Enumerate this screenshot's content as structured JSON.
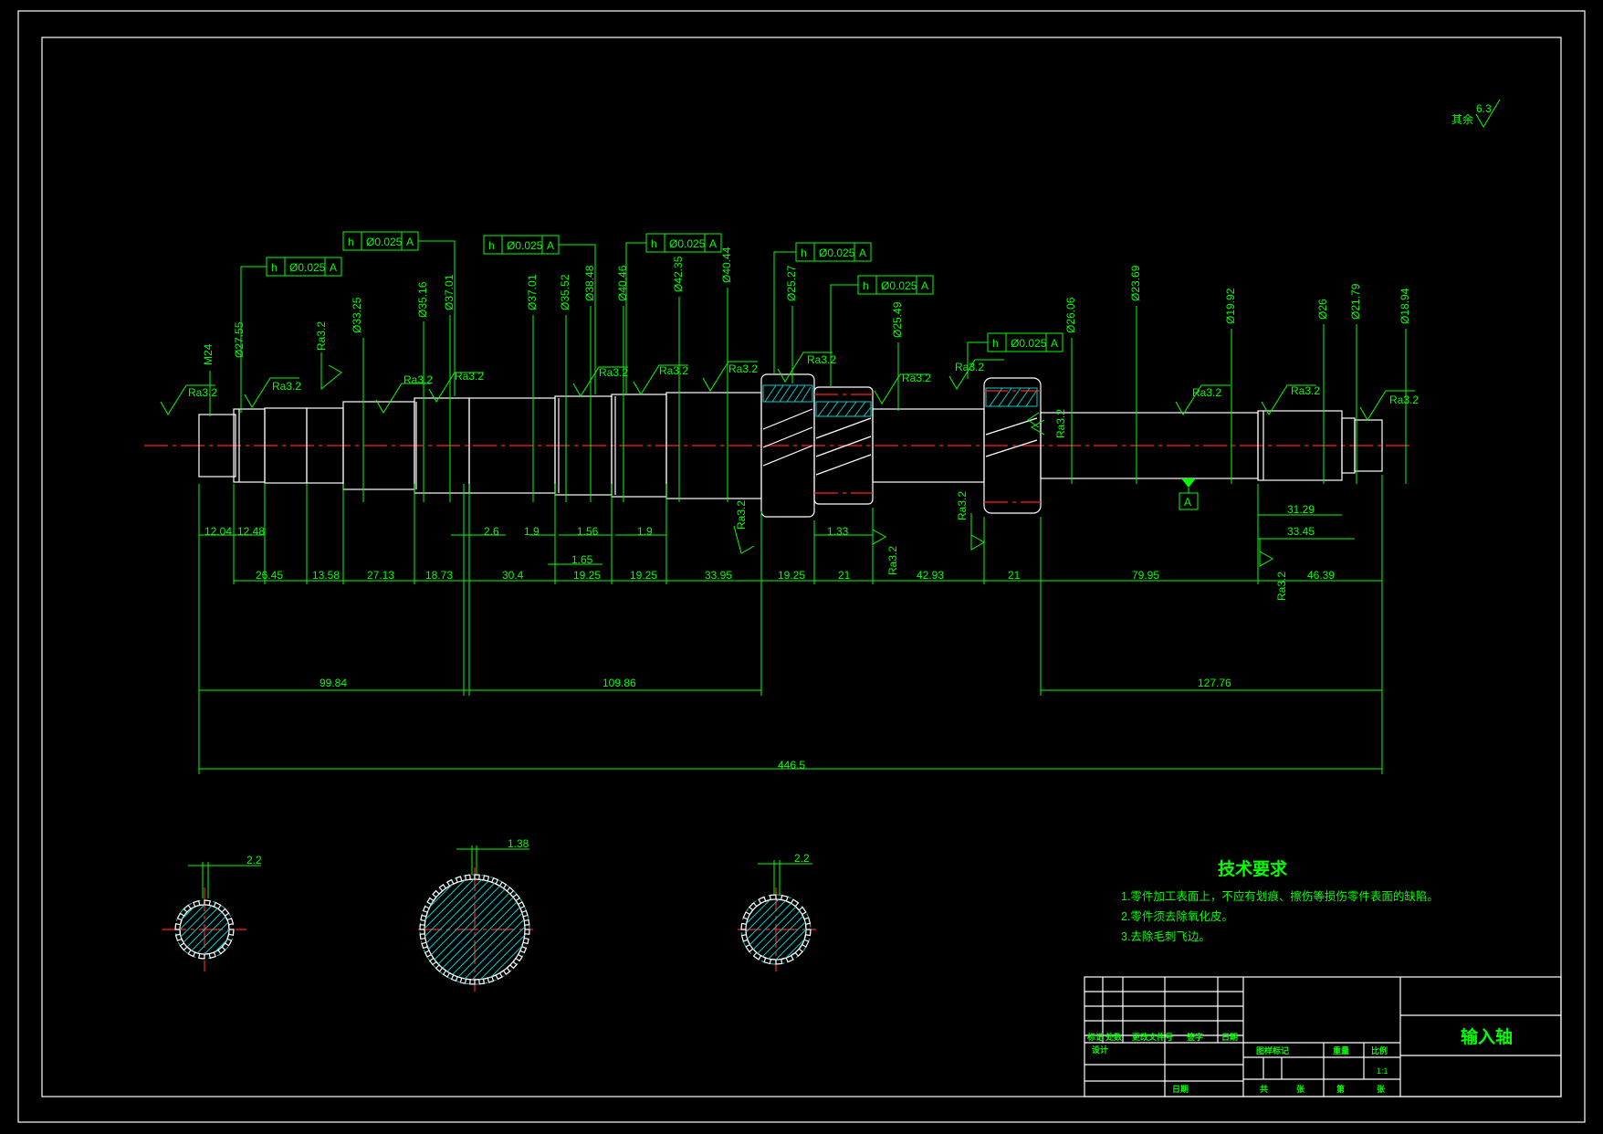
{
  "corner_roughness": {
    "prefix": "其余",
    "value": "6.3"
  },
  "diameters": [
    "M24",
    "Ø27.55",
    "Ø33.25",
    "Ø35.16",
    "Ø37.01",
    "Ø37.01",
    "Ø35.52",
    "Ø38.48",
    "Ø40.46",
    "Ø42.35",
    "Ø40.44",
    "Ø25.27",
    "Ø25.49",
    "Ø26.06",
    "Ø23.69",
    "Ø19.92",
    "Ø26",
    "Ø21.79",
    "Ø18.94"
  ],
  "roughness": [
    "Ra3.2",
    "Ra3.2",
    "Ra3.2",
    "Ra3.2",
    "Ra3.2",
    "Ra3.2",
    "Ra3.2",
    "Ra3.2",
    "Ra3.2",
    "Ra3.2",
    "Ra3.2",
    "Ra3.2",
    "Ra3.2",
    "Ra3.2",
    "Ra3.2",
    "Ra3.2",
    "Ra3.2",
    "Ra3.2",
    "Ra3.2",
    "Ra3.2"
  ],
  "tolerance_frames": [
    {
      "symbol": "h",
      "value": "Ø0.025",
      "datum": "A"
    },
    {
      "symbol": "h",
      "value": "Ø0.025",
      "datum": "A"
    },
    {
      "symbol": "h",
      "value": "Ø0.025",
      "datum": "A"
    },
    {
      "symbol": "h",
      "value": "Ø0.025",
      "datum": "A"
    },
    {
      "symbol": "h",
      "value": "Ø0.025",
      "datum": "A"
    },
    {
      "symbol": "h",
      "value": "Ø0.025",
      "datum": "A"
    },
    {
      "symbol": "h",
      "value": "Ø0.025",
      "datum": "A"
    }
  ],
  "datum_label": "A",
  "dims_row1": [
    "12.04",
    "12.48",
    "2.6",
    "1.9",
    "1.56",
    "1.9",
    "1.33",
    "31.29",
    "33.45",
    "1.65"
  ],
  "dims_row2": [
    "26.45",
    "13.58",
    "27.13",
    "18.73",
    "30.4",
    "19.25",
    "19.25",
    "33.95",
    "19.25",
    "21",
    "42.93",
    "21",
    "79.95",
    "46.39"
  ],
  "dims_row3": [
    "99.84",
    "109.86",
    "127.76"
  ],
  "dim_total": "446.5",
  "spline_dims": [
    "2.2",
    "1.38",
    "2.2"
  ],
  "tech": {
    "title": "技术要求",
    "items": [
      "1.零件加工表面上，不应有划痕、擦伤等损伤零件表面的缺陷。",
      "2.零件须去除氧化皮。",
      "3.去除毛刺飞边。"
    ]
  },
  "title_block": {
    "part_name": "输入轴",
    "labels": [
      "标记",
      "处数",
      "更改文件号",
      "签字",
      "日期",
      "设计",
      "日期",
      "图样标记",
      "重量",
      "比例",
      "共",
      "张",
      "第",
      "张"
    ],
    "scale": "1:1"
  }
}
